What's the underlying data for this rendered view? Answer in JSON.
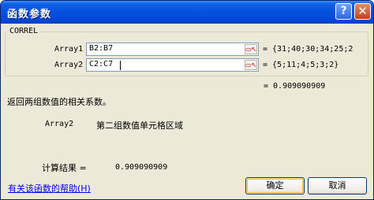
{
  "window": {
    "title": "函数参数"
  },
  "titlebar_buttons": {
    "help": "?",
    "close": "✕"
  },
  "group": {
    "function_name": "CORREL"
  },
  "args": [
    {
      "label": "Array1",
      "value": "B2:B7",
      "result": "= {31;40;30;34;25;2"
    },
    {
      "label": "Array2",
      "value": "C2:C7",
      "result": "= {5;11;4;5;3;2}"
    }
  ],
  "formula_result": "= 0.909090909",
  "description": "返回两组数值的相关系数。",
  "arg_help": {
    "name": "Array2",
    "text": "第二组数值单元格区域"
  },
  "calc": {
    "label": "计算结果 =",
    "value": "0.909090909"
  },
  "help_link": "有关该函数的帮助(H)",
  "buttons": {
    "ok": "确定",
    "cancel": "取消"
  }
}
